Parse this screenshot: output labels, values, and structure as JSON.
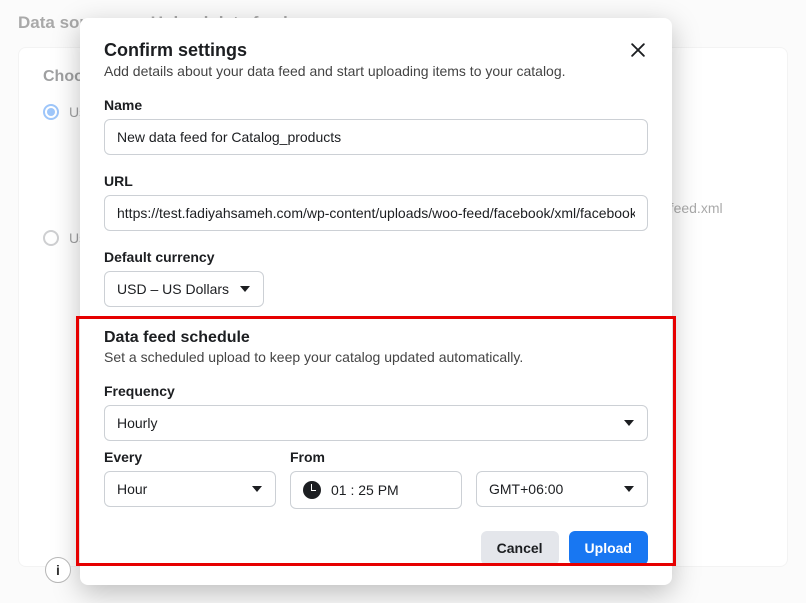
{
  "breadcrumb": {
    "first": "Data sources",
    "second": "Upload data feed"
  },
  "background": {
    "choose_heading": "Choose upload option",
    "radio1_label": "Use a URL",
    "radio2_label": "Use a file",
    "url_example": "lacefeed.xml",
    "help_glyph": "i"
  },
  "modal": {
    "title": "Confirm settings",
    "subtitle": "Add details about your data feed and start uploading items to your catalog.",
    "close": "×",
    "name_label": "Name",
    "name_value": "New data feed for Catalog_products",
    "url_label": "URL",
    "url_value": "https://test.fadiyahsameh.com/wp-content/uploads/woo-feed/facebook/xml/facebook",
    "currency_label": "Default currency",
    "currency_value": "USD – US Dollars",
    "schedule": {
      "title": "Data feed schedule",
      "subtitle": "Set a scheduled upload to keep your catalog updated automatically.",
      "frequency_label": "Frequency",
      "frequency_value": "Hourly",
      "every_label": "Every",
      "every_value": "Hour",
      "from_label": "From",
      "time_value": "01 : 25 PM",
      "tz_value": "GMT+06:00"
    },
    "actions": {
      "cancel": "Cancel",
      "upload": "Upload"
    }
  }
}
